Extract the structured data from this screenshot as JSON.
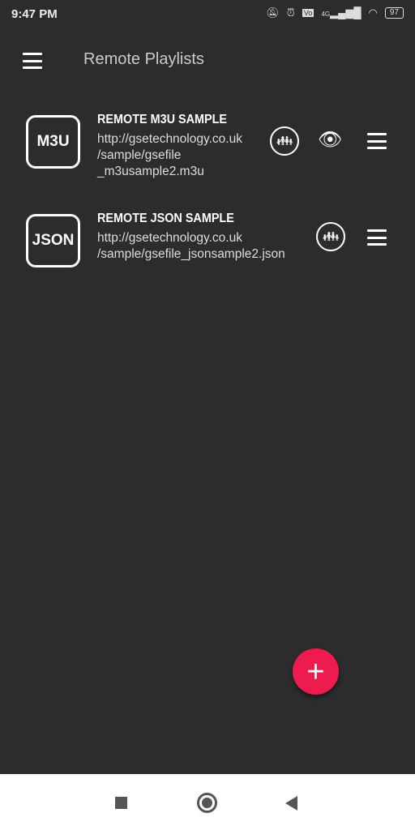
{
  "status": {
    "time": "9:47 PM",
    "battery": "97",
    "network": "4G"
  },
  "appbar": {
    "title": "Remote Playlists"
  },
  "playlists": [
    {
      "icon_label": "M3U",
      "name": "REMOTE M3U SAMPLE",
      "url_lines": [
        "http://gsetechnology.co.uk",
        "/sample/gsefile",
        "_m3usample2.m3u"
      ],
      "hidden_icon": true
    },
    {
      "icon_label": "JSON",
      "name": "REMOTE JSON SAMPLE",
      "url_lines": [
        "http://gsetechnology.co.uk",
        "/sample/gsefile_jsonsample2.json"
      ],
      "hidden_icon": false
    }
  ],
  "fab": {
    "label": "+",
    "color": "#ee1c4e"
  }
}
